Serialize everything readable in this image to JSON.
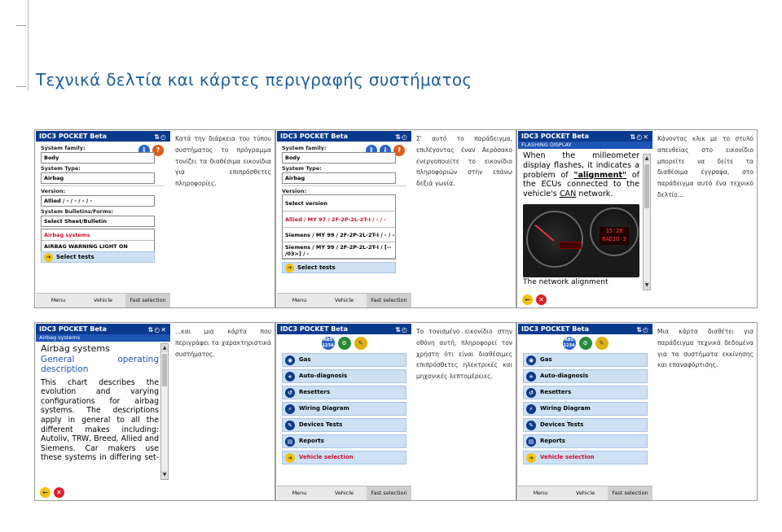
{
  "page": {
    "title": "Τεχνικά δελτία και κάρτες περιγραφής συστήματος"
  },
  "app": {
    "name": "IDC3 POCKET Beta",
    "nav": {
      "menu": "Menu",
      "vehicle": "Vehicle",
      "fast": "Fast selection"
    }
  },
  "p1": {
    "system_family_label": "System family:",
    "system_family": "Body",
    "system_type_label": "System Type:",
    "system_type": "Airbag",
    "version_label": "Version:",
    "version": "Allied / - / - / - / -",
    "bulletins_label": "System Bulletins/Forms:",
    "bulletin_select": "Select Sheet/Bulletin",
    "list": [
      "Airbag systems",
      "AIRBAG WARNING LIGHT ON"
    ],
    "select_tests": "Select tests",
    "desc": "Κατά την διάρκεια του τύπου συστήματος το πρόγραμμα τονίζει τα διαθέσιμα εικονίδια για επιπρόσθετες πληροφορίες."
  },
  "p2": {
    "system_family_label": "System family:",
    "system_family": "Body",
    "system_type_label": "System Type:",
    "system_type": "Airbag",
    "version_label": "Version:",
    "versions": [
      "Select version",
      "Allied / MY 97 / 2F-2P-2L-2T-I / - / -",
      "Siemens / MY 99 / 2F-2P-2L-2T-I / - / -",
      "Siemens / MY 99 / 2F-2P-2L-2T-I / [-- /03>] / -"
    ],
    "select_tests": "Select tests",
    "desc": "Σ' αυτό το παράδειγμα, επιλέγοντας έναν Αερόσακο ενεργοποιείτε το εικονίδιο πληροφοριών στην επάνω δεξιά γωνία."
  },
  "p3": {
    "subtitle": "FLASHING DISPLAY",
    "text_a": "When the milleometer display flashes, it indicates a problem of ",
    "text_b": "\"alignment\"",
    "text_c": " of the ECUs connected to the vehicle's ",
    "text_d": "CAN",
    "text_e": " network.",
    "lcd": "15:28 RADIO 3",
    "text_tail": "The network alignment",
    "desc": "Κάνοντας κλικ με το στυλό απευθείας στο εικονίδιο μπορείτε να δείτε τα διαθέσιμα έγγραφα, στο παράδειγμα αυτό ένα τεχνικό δελτίο..."
  },
  "p4": {
    "subtitle": "Airbag systems",
    "heading": "Airbag systems",
    "subheading": "General operating description",
    "body": "This chart describes the evolution and varying configurations for airbag systems. The descriptions apply in general to all the different makes including: Autoliv, TRW, Breed, Allied and Siemens. Car makers use these systems in differing set-ups. The",
    "desc": "...και μια κάρτα που περιγράφει τα χαρακτηριστικά συστήματος."
  },
  "p5": {
    "menu": [
      "Gas",
      "Auto-diagnosis",
      "Resetters",
      "Wiring Diagram",
      "Devices Tests",
      "Reports",
      "Vehicle selection"
    ],
    "abs": "ABS 1234",
    "desc": "Το τονισμένο εικονίδιο στην οθόνη αυτή, πληροφορεί τον χρήστη ότι είναι διαθέσιμες επιπρόσθετες ηλεκτρικές και μηχανικές λεπτομέρειες."
  },
  "p6": {
    "menu": [
      "Gas",
      "Auto-diagnosis",
      "Resetters",
      "Wiring Diagram",
      "Devices Tests",
      "Reports",
      "Vehicle selection"
    ],
    "abs": "ABS 1234",
    "desc": "Μια κάρτα διαθέτει για παράδειγμα τεχνικά δεδομένα για τα συστήματα εκκίνησης και επαναφόρτισης."
  },
  "icons": {
    "info": "info-icon",
    "help": "help-icon",
    "bluetooth": "bluetooth-icon",
    "back": "back-icon",
    "close": "close-icon"
  }
}
